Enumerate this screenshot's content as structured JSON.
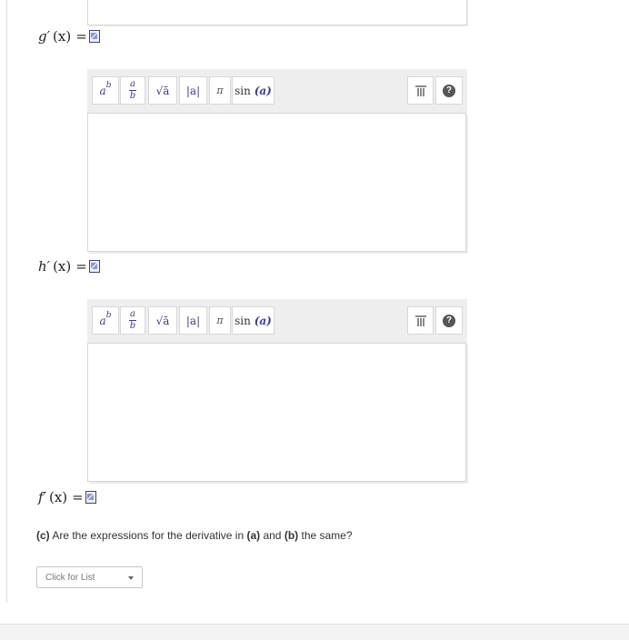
{
  "labels": {
    "g_fn": "g",
    "h_fn": "h",
    "f_fn": "f",
    "prime": "′",
    "var": "(x)",
    "equals": "="
  },
  "toolbar": {
    "power_base": "a",
    "power_exp": "b",
    "frac_num": "a",
    "frac_den": "b",
    "sqrt": "√ā",
    "abs": "|a|",
    "pi": "π",
    "sin_prefix": "sin",
    "sin_arg": "(a)",
    "help": "?"
  },
  "question": {
    "part": "(c)",
    "text_1": " Are the expressions for the derivative in ",
    "ref_a": "(a)",
    "text_2": " and ",
    "ref_b": "(b)",
    "text_3": " the same?"
  },
  "select": {
    "value": "Click for List"
  }
}
